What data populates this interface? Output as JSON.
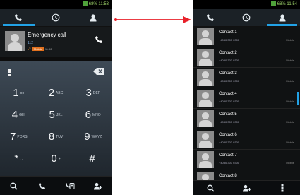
{
  "status": {
    "text": "68% 11:53",
    "right_text": "68% 11:54"
  },
  "left": {
    "call_entry": {
      "name": "Emergency call",
      "number": "112",
      "tag": "Mobile",
      "time": "11:52"
    },
    "keys": [
      [
        {
          "digit": "1",
          "letters": "oo"
        },
        {
          "digit": "2",
          "letters": "ABC"
        },
        {
          "digit": "3",
          "letters": "DEF"
        }
      ],
      [
        {
          "digit": "4",
          "letters": "GHI"
        },
        {
          "digit": "5",
          "letters": "JKL"
        },
        {
          "digit": "6",
          "letters": "MNO"
        }
      ],
      [
        {
          "digit": "7",
          "letters": "PQRS"
        },
        {
          "digit": "8",
          "letters": "TUV"
        },
        {
          "digit": "9",
          "letters": "WXYZ"
        }
      ],
      [
        {
          "digit": "*",
          "letters": ", ;"
        },
        {
          "digit": "0",
          "letters": "+"
        },
        {
          "digit": "#",
          "letters": ""
        }
      ]
    ]
  },
  "right": {
    "contacts": [
      {
        "name": "Contact 1",
        "number": "+4030 303 0300",
        "type": "Mobile"
      },
      {
        "name": "Contact 2",
        "number": "+4030 303 0300",
        "type": "Mobile"
      },
      {
        "name": "Contact 3",
        "number": "+4030 303 0300",
        "type": "Mobile"
      },
      {
        "name": "Contact 4",
        "number": "+4030 303 0300",
        "type": "Mobile"
      },
      {
        "name": "Contact 5",
        "number": "+4030 303 0300",
        "type": "Mobile"
      },
      {
        "name": "Contact 6",
        "number": "+4030 303 0300",
        "type": "Mobile"
      },
      {
        "name": "Contact 7",
        "number": "+4030 303 0300",
        "type": "Mobile"
      },
      {
        "name": "Contact 8",
        "number": "+4030 303 0300",
        "type": "Mobile"
      }
    ]
  },
  "colors": {
    "accent": "#22a2e6",
    "arrow": "#e8202a",
    "tag": "#e0701e"
  }
}
